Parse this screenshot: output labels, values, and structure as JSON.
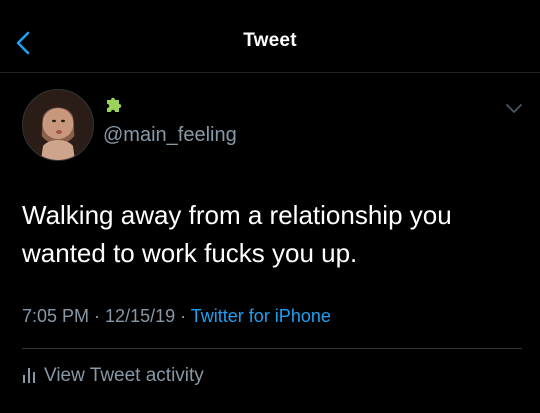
{
  "header": {
    "title": "Tweet",
    "back_icon": "chevron-left-icon"
  },
  "tweet": {
    "handle": "@main_feeling",
    "badge_icon": "puzzle-piece-icon",
    "text": "Walking away from a relationship you wanted to work fucks you up.",
    "time": "7:05 PM",
    "separator": " · ",
    "date": "12/15/19",
    "source": "Twitter for iPhone",
    "menu_icon": "chevron-down-icon"
  },
  "footer": {
    "activity_label": "View Tweet activity",
    "activity_icon": "bar-chart-icon"
  },
  "colors": {
    "background": "#000000",
    "text": "#ffffff",
    "secondary": "#8899a6",
    "accent": "#1da1f2",
    "badge": "#9bd35a"
  }
}
